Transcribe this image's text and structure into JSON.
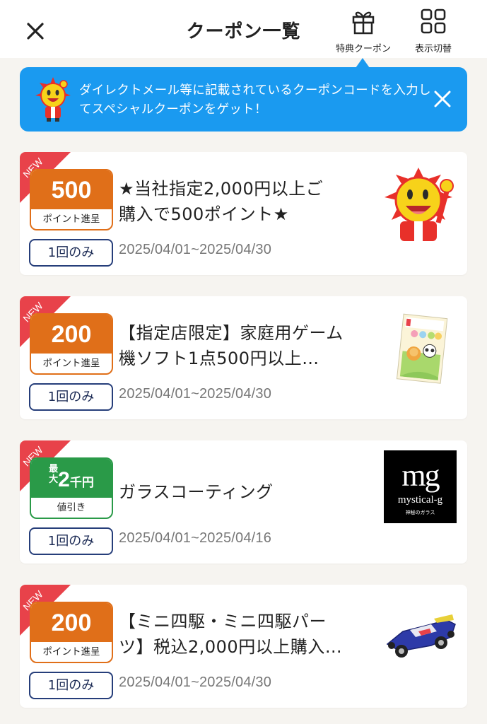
{
  "header": {
    "title": "クーポン一覧",
    "gift_label": "特典クーポン",
    "view_label": "表示切替"
  },
  "banner": {
    "text": "ダイレクトメール等に記載されているクーポンコードを入力してスペシャルクーポンをゲット！"
  },
  "colors": {
    "accent_blue": "#1a9af0",
    "point_orange": "#e06f19",
    "discount_green": "#2a9a48",
    "new_red": "#e8424a",
    "tag_navy": "#263e7a"
  },
  "coupons": [
    {
      "new_label": "NEW",
      "badge_value": "500",
      "badge_caption": "ポイント進呈",
      "limit": "1回のみ",
      "title_line1": "★当社指定2,000円以上ご",
      "title_line2": "購入で500ポイント★",
      "period": "2025/04/01~2025/04/30",
      "image": "mascot-sun-character"
    },
    {
      "new_label": "NEW",
      "badge_value": "200",
      "badge_caption": "ポイント進呈",
      "limit": "1回のみ",
      "title_line1": "【指定店限定】家庭用ゲーム",
      "title_line2": "機ソフト1点500円以上…",
      "period": "2025/04/01~2025/04/30",
      "image": "game-software-box"
    },
    {
      "new_label": "NEW",
      "badge_prefix_top": "最",
      "badge_prefix_bottom": "大",
      "badge_value": "2",
      "badge_unit": "千円",
      "badge_caption": "値引き",
      "limit": "1回のみ",
      "title_line1": "ガラスコーティング",
      "period": "2025/04/01~2025/04/16",
      "image": "mystical-g-logo",
      "logo_mark": "mg",
      "logo_name": "mystical-g",
      "logo_sub": "神秘のガラス"
    },
    {
      "new_label": "NEW",
      "badge_value": "200",
      "badge_caption": "ポイント進呈",
      "limit": "1回のみ",
      "title_line1": "【ミニ四駆・ミニ四駆パー",
      "title_line2": "ツ】税込2,000円以上購入…",
      "period": "2025/04/01~2025/04/30",
      "image": "mini-4wd-car"
    }
  ]
}
